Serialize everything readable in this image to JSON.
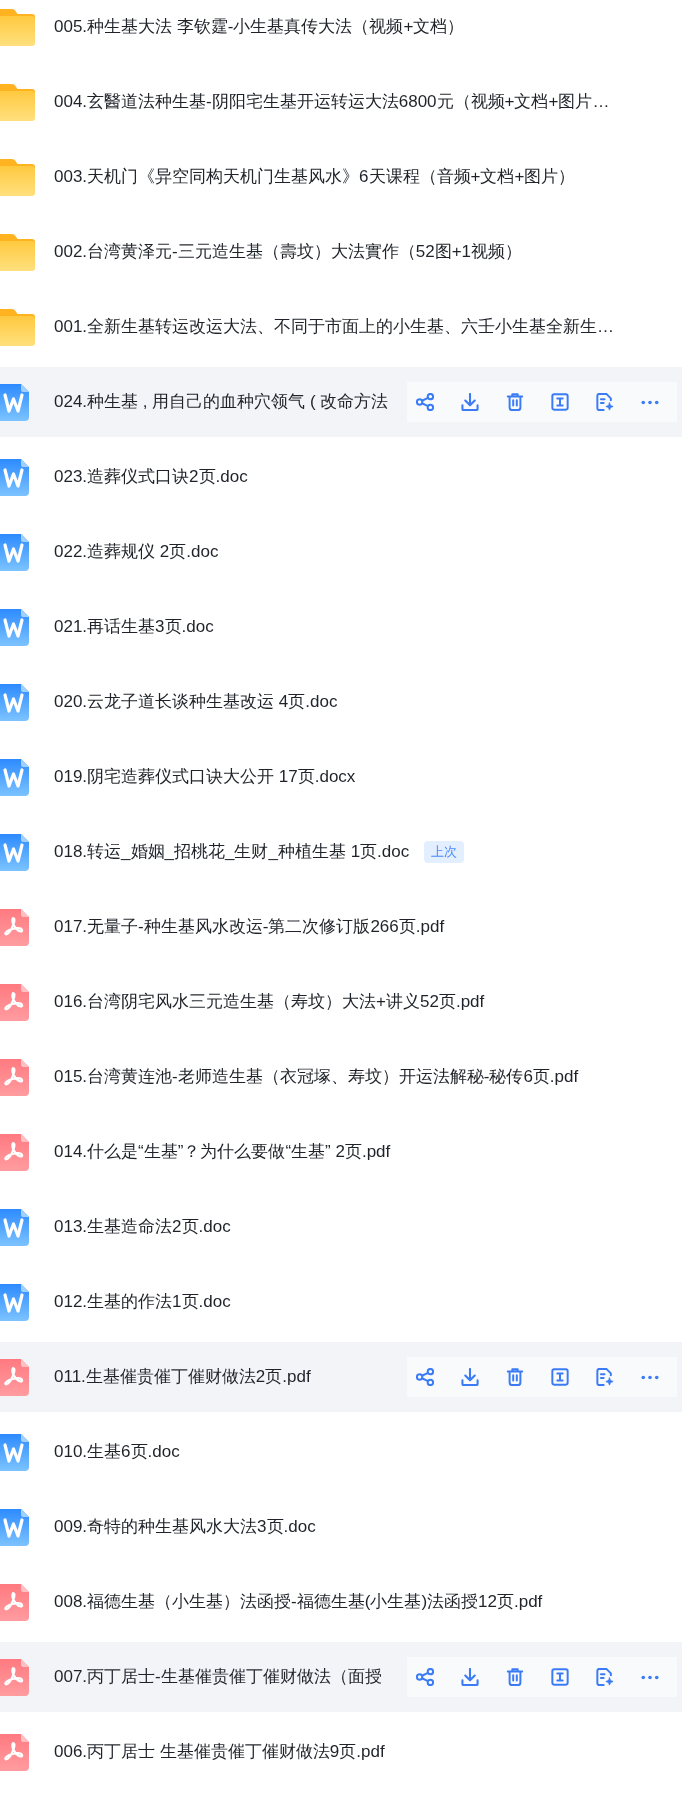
{
  "items": [
    {
      "kind": "folder",
      "name": "005.种生基大法 李钦霆-小生基真传大法（视频+文档）",
      "hovered": false
    },
    {
      "kind": "folder",
      "name": "004.玄醫道法种生基-阴阳宅生基开运转运大法6800元（视频+文档+图片…",
      "hovered": false
    },
    {
      "kind": "folder",
      "name": "003.天机门《异空同构天机门生基风水》6天课程（音频+文档+图片）",
      "hovered": false
    },
    {
      "kind": "folder",
      "name": "002.台湾黄泽元-三元造生基（壽坟）大法實作（52图+1视频）",
      "hovered": false
    },
    {
      "kind": "folder",
      "name": "001.全新生基转运改运大法、不同于市面上的小生基、六壬小生基全新生…",
      "hovered": false
    },
    {
      "kind": "word",
      "name": "024.种生基 , 用自己的血种穴领气 ( 改命方法",
      "hovered": true
    },
    {
      "kind": "word",
      "name": "023.造葬仪式口诀2页.doc",
      "hovered": false
    },
    {
      "kind": "word",
      "name": "022.造葬规仪 2页.doc",
      "hovered": false
    },
    {
      "kind": "word",
      "name": "021.再话生基3页.doc",
      "hovered": false
    },
    {
      "kind": "word",
      "name": "020.云龙子道长谈种生基改运 4页.doc",
      "hovered": false
    },
    {
      "kind": "word",
      "name": "019.阴宅造葬仪式口诀大公开 17页.docx",
      "hovered": false
    },
    {
      "kind": "word",
      "name": "018.转运_婚姻_招桃花_生财_种植生基 1页.doc",
      "hovered": false,
      "badge": "上次"
    },
    {
      "kind": "pdf",
      "name": "017.无量子-种生基风水改运-第二次修订版266页.pdf",
      "hovered": false
    },
    {
      "kind": "pdf",
      "name": "016.台湾阴宅风水三元造生基（寿坟）大法+讲义52页.pdf",
      "hovered": false
    },
    {
      "kind": "pdf",
      "name": "015.台湾黄连池-老师造生基（衣冠塚、寿坟）开运法解秘-秘传6页.pdf",
      "hovered": false
    },
    {
      "kind": "pdf",
      "name": "014.什么是“生基”？为什么要做“生基” 2页.pdf",
      "hovered": false
    },
    {
      "kind": "word",
      "name": "013.生基造命法2页.doc",
      "hovered": false
    },
    {
      "kind": "word",
      "name": "012.生基的作法1页.doc",
      "hovered": false
    },
    {
      "kind": "pdf",
      "name": "011.生基催贵催丁催财做法2页.pdf",
      "hovered": true
    },
    {
      "kind": "word",
      "name": "010.生基6页.doc",
      "hovered": false
    },
    {
      "kind": "word",
      "name": "009.奇特的种生基风水大法3页.doc",
      "hovered": false
    },
    {
      "kind": "pdf",
      "name": "008.福德生基（小生基）法函授-福德生基(小生基)法函授12页.pdf",
      "hovered": false
    },
    {
      "kind": "pdf",
      "name": "007.丙丁居士-生基催贵催丁催财做法（面授",
      "hovered": true
    },
    {
      "kind": "pdf",
      "name": "006.丙丁居士 生基催贵催丁催财做法9页.pdf",
      "hovered": false
    }
  ]
}
